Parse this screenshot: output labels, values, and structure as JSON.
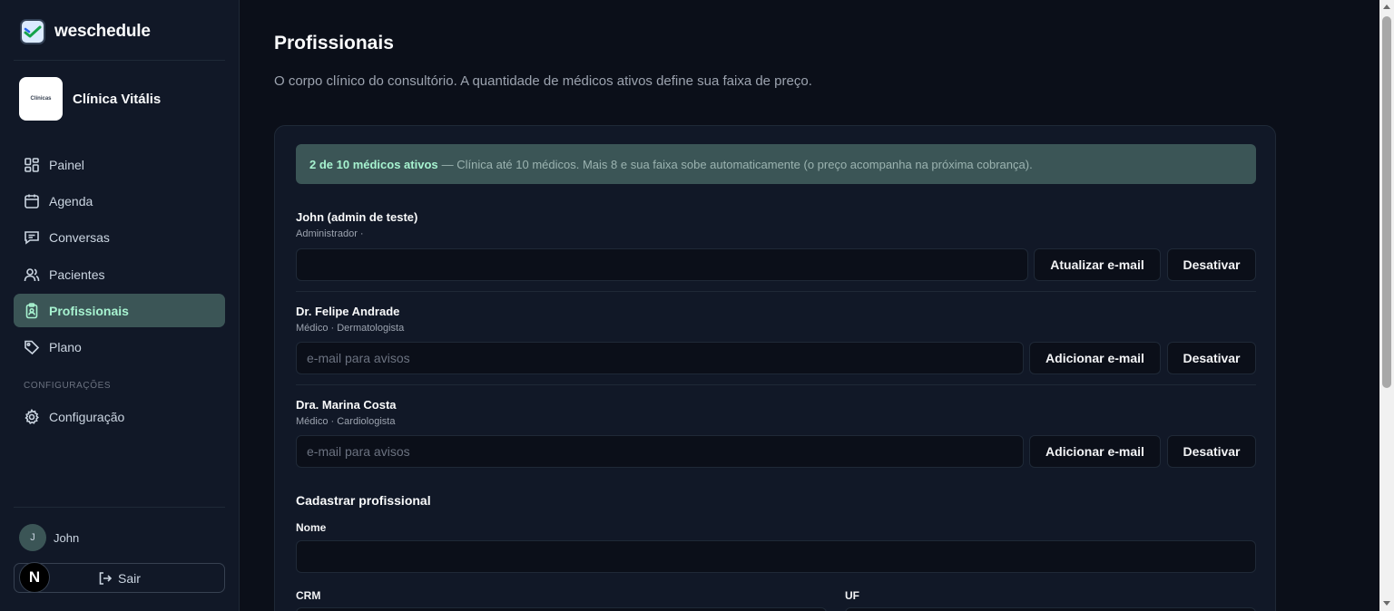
{
  "brand": {
    "name": "weschedule"
  },
  "clinic": {
    "name": "Clínica Vitális",
    "logo_text": "Clínicas"
  },
  "sidebar": {
    "items": [
      {
        "label": "Painel",
        "icon": "dashboard-icon"
      },
      {
        "label": "Agenda",
        "icon": "calendar-icon"
      },
      {
        "label": "Conversas",
        "icon": "chat-icon"
      },
      {
        "label": "Pacientes",
        "icon": "users-icon"
      },
      {
        "label": "Profissionais",
        "icon": "clipboard-icon",
        "active": true
      },
      {
        "label": "Plano",
        "icon": "tag-icon"
      }
    ],
    "section_label": "CONFIGURAÇÕES",
    "settings_label": "Configuração",
    "user": {
      "initial": "J",
      "name": "John"
    },
    "logout_label": "Sair",
    "n_badge": "N"
  },
  "main": {
    "title": "Profissionais",
    "subtitle": "O corpo clínico do consultório. A quantidade de médicos ativos define sua faixa de preço.",
    "banner": {
      "strong": "2 de 10 médicos ativos",
      "text": "— Clínica até 10 médicos. Mais 8 e sua faixa sobe automaticamente (o preço acompanha na próxima cobrança)."
    },
    "professionals": [
      {
        "name": "John (admin de teste)",
        "role": "Administrador ·",
        "email_value": "",
        "email_placeholder": "",
        "email_button": "Atualizar e-mail",
        "deactivate_button": "Desativar"
      },
      {
        "name": "Dr. Felipe Andrade",
        "role": "Médico · Dermatologista",
        "email_value": "",
        "email_placeholder": "e-mail para avisos",
        "email_button": "Adicionar e-mail",
        "deactivate_button": "Desativar"
      },
      {
        "name": "Dra. Marina Costa",
        "role": "Médico · Cardiologista",
        "email_value": "",
        "email_placeholder": "e-mail para avisos",
        "email_button": "Adicionar e-mail",
        "deactivate_button": "Desativar"
      }
    ],
    "form": {
      "title": "Cadastrar profissional",
      "name_label": "Nome",
      "crm_label": "CRM",
      "uf_label": "UF"
    }
  },
  "colors": {
    "background": "#0b0f19",
    "sidebar": "#111827",
    "accent": "#3b5556",
    "accent_text": "#a7f3d0"
  }
}
